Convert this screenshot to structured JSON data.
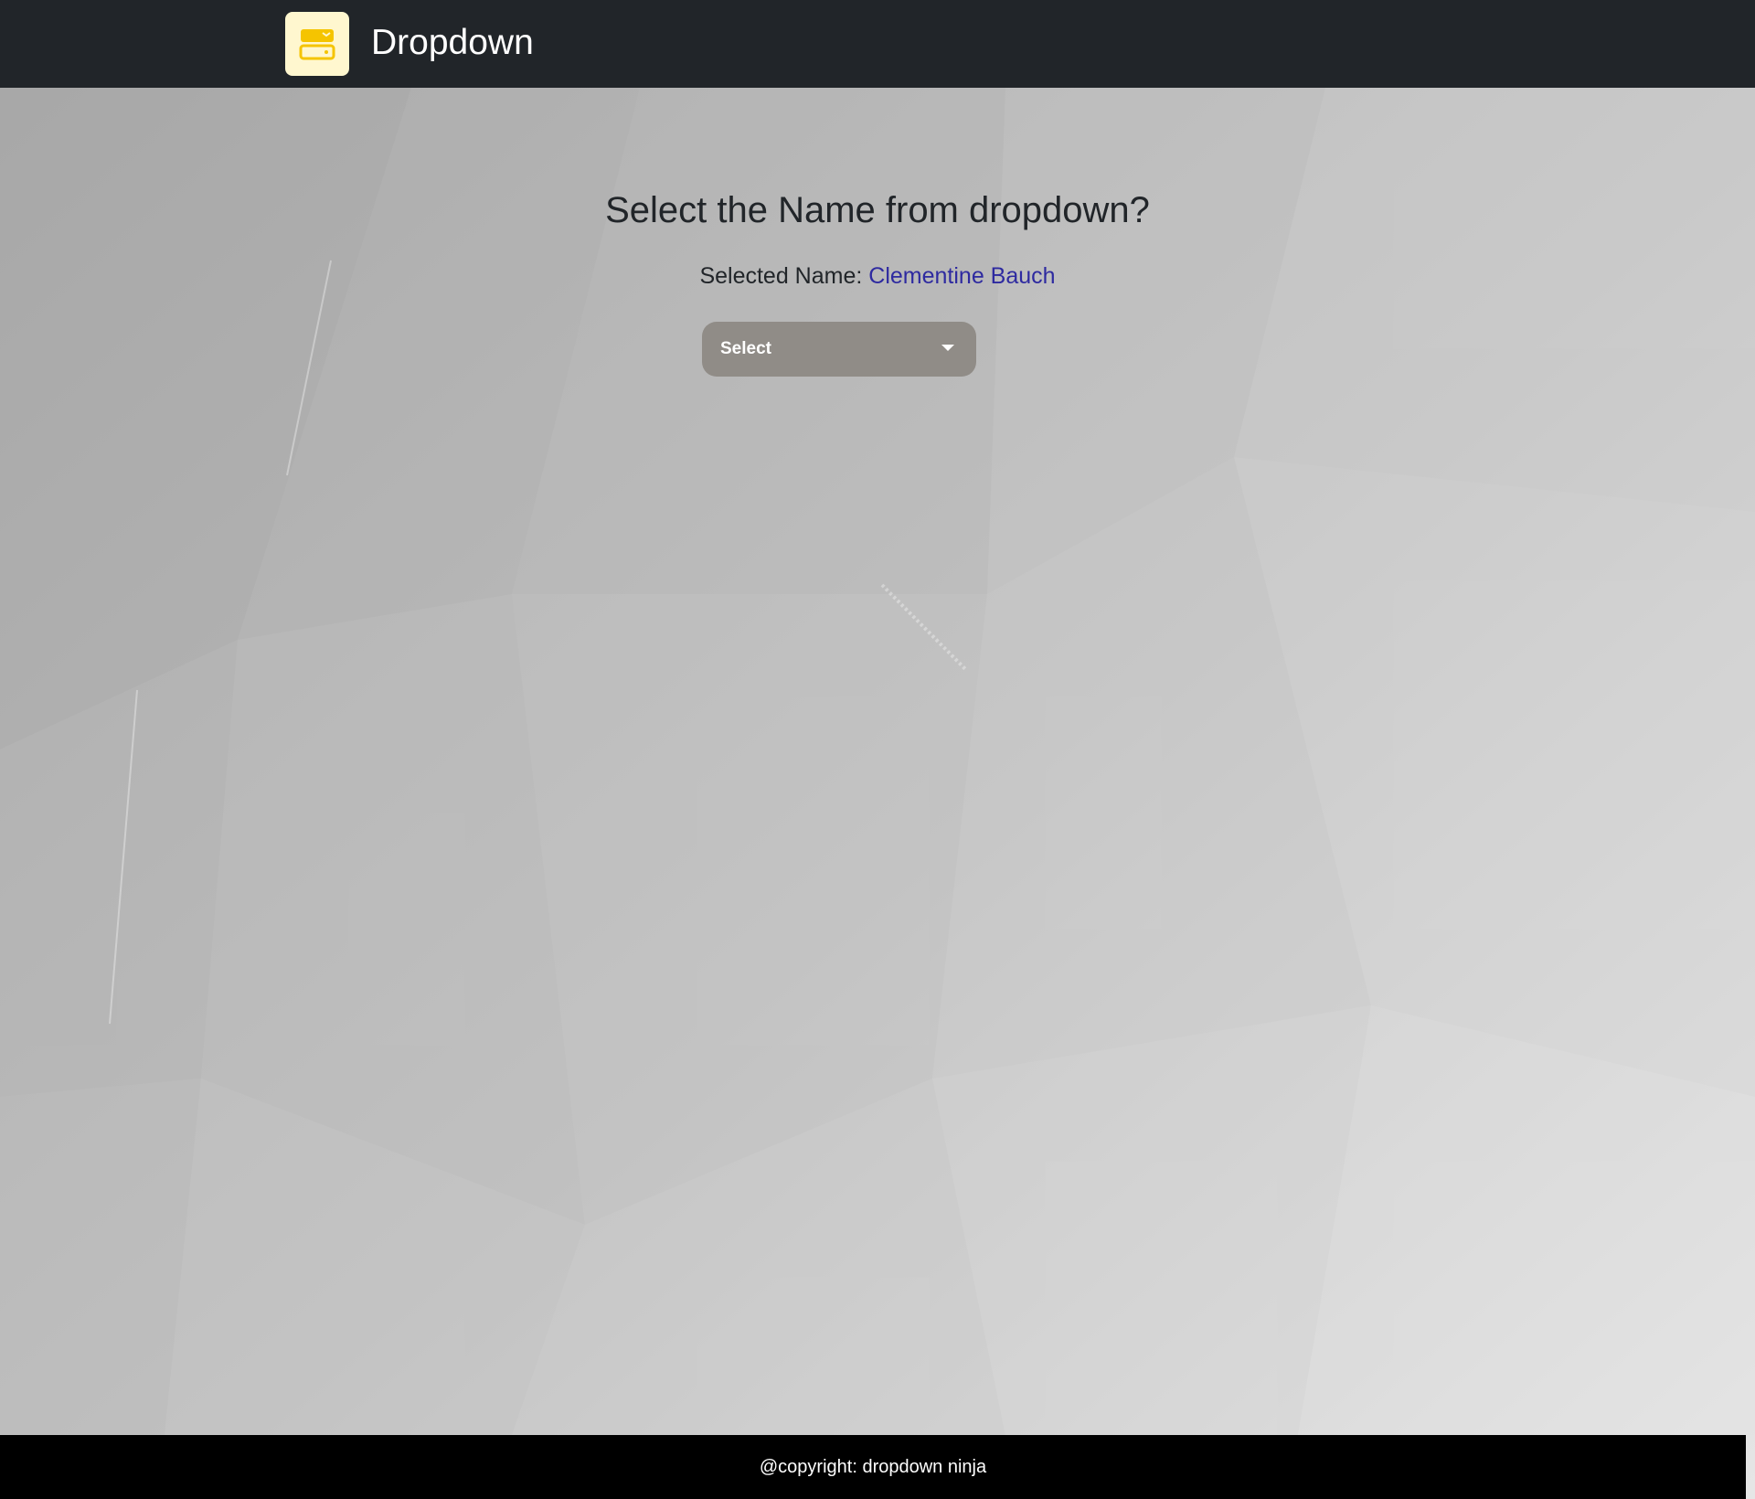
{
  "navbar": {
    "brand_title": "Dropdown",
    "logo_icon": "server-box-icon",
    "background_color": "#212529",
    "logo_background_color": "#fff7cf",
    "logo_accent_color": "#f5c400"
  },
  "main": {
    "heading": "Select the Name from dropdown?",
    "selected_label": "Selected Name:",
    "selected_value": "Clementine Bauch",
    "selected_value_color": "#2e2aa0",
    "dropdown": {
      "label": "Select",
      "icon": "caret-down-icon",
      "background_color": "#908c87"
    }
  },
  "footer": {
    "text": "@copyright: dropdown ninja",
    "background_color": "#000000"
  }
}
